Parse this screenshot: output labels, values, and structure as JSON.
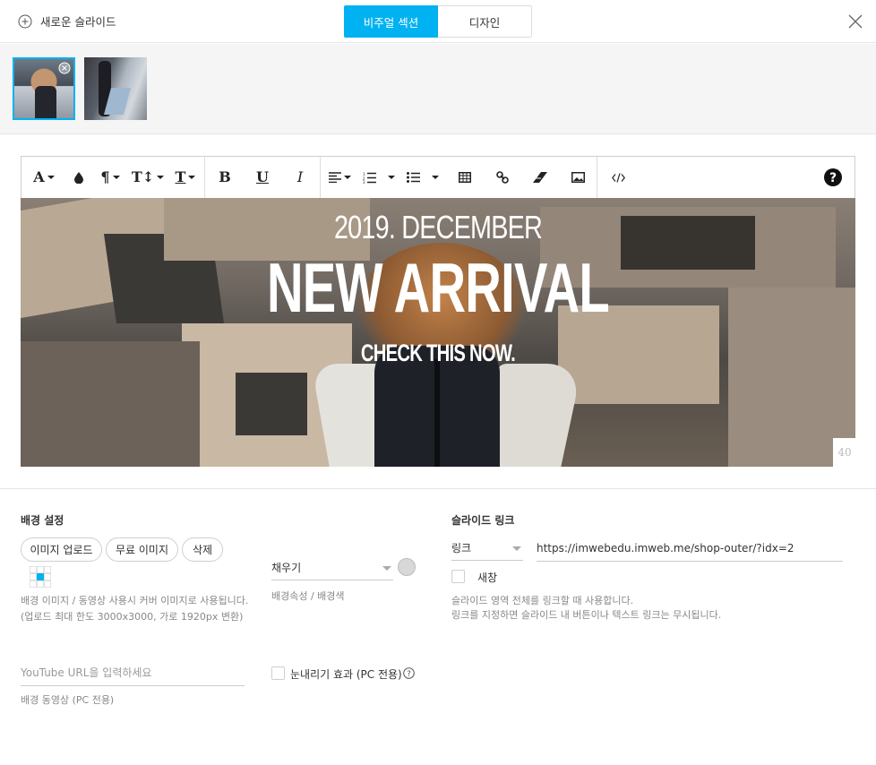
{
  "header": {
    "new_slide_label": "새로운 슬라이드",
    "tabs": [
      "비주얼 섹션",
      "디자인"
    ],
    "active_tab": "비주얼 섹션"
  },
  "thumbnails": {
    "count": 2,
    "selected": 1
  },
  "editor": {
    "toolbar": [
      "font-color",
      "highlight",
      "paragraph",
      "font-size",
      "font-style",
      "bold",
      "underline",
      "italic",
      "align",
      "ordered-list",
      "unordered-list",
      "table",
      "link",
      "eraser",
      "image",
      "code-view",
      "help"
    ],
    "banner": {
      "line1": "2019. DECEMBER",
      "line2": "NEW ARRIVAL",
      "line3": "CHECK THIS NOW."
    },
    "height_value": "40"
  },
  "background": {
    "title": "배경 설정",
    "buttons": {
      "upload": "이미지 업로드",
      "free": "무료 이미지",
      "delete": "삭제"
    },
    "help_line1": "배경 이미지 / 동영상 사용시 커버 이미지로 사용됩니다.",
    "help_line2": "(업로드 최대 한도 3000x3000, 가로 1920px 변환)",
    "fill_select": "채우기",
    "fill_help": "배경속성 / 배경색",
    "youtube_placeholder": "YouTube URL을 입력하세요",
    "video_help": "배경 동영상 (PC 전용)",
    "snow_label": "눈내리기 효과 (PC 전용)",
    "position_selected": "center",
    "colors": {
      "accent": "#00b2f1",
      "swatch": "#d8d8d8"
    }
  },
  "slide_link": {
    "title": "슬라이드 링크",
    "type_select": "링크",
    "url": "https://imwebedu.imweb.me/shop-outer/?idx=2",
    "new_window_label": "새창",
    "help_line1": "슬라이드 영역 전체를 링크할 때 사용합니다.",
    "help_line2": "링크를 지정하면 슬라이드 내 버튼이나 텍스트 링크는 무시됩니다."
  }
}
